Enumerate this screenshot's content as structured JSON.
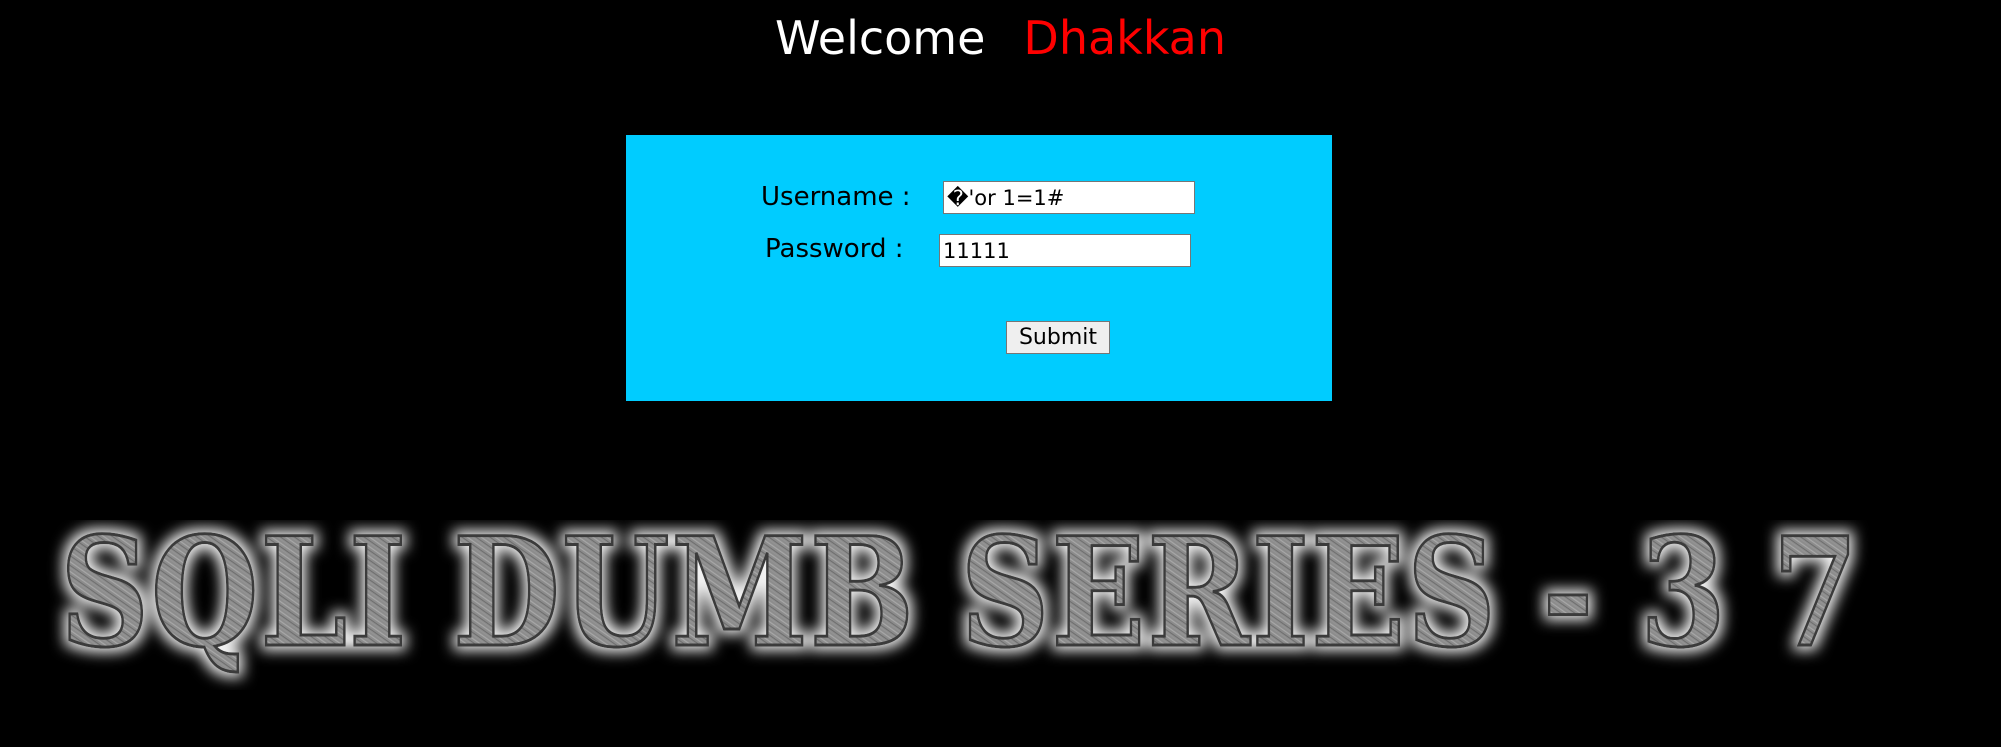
{
  "header": {
    "welcome_label": "Welcome",
    "user_name": "Dhakkan"
  },
  "login": {
    "username_label": "Username :",
    "username_value": "�'or 1=1#",
    "password_label": "Password :",
    "password_value": "11111",
    "submit_label": "Submit"
  },
  "banner": {
    "text": "SQLI DUMB SERIES - 3 7"
  },
  "colors": {
    "background": "#000000",
    "panel": "#00ccff",
    "welcome_text": "#ffffff",
    "user_name_text": "#ff0000",
    "banner_fill": "#8a8a8a",
    "banner_glow": "#ffffff"
  }
}
